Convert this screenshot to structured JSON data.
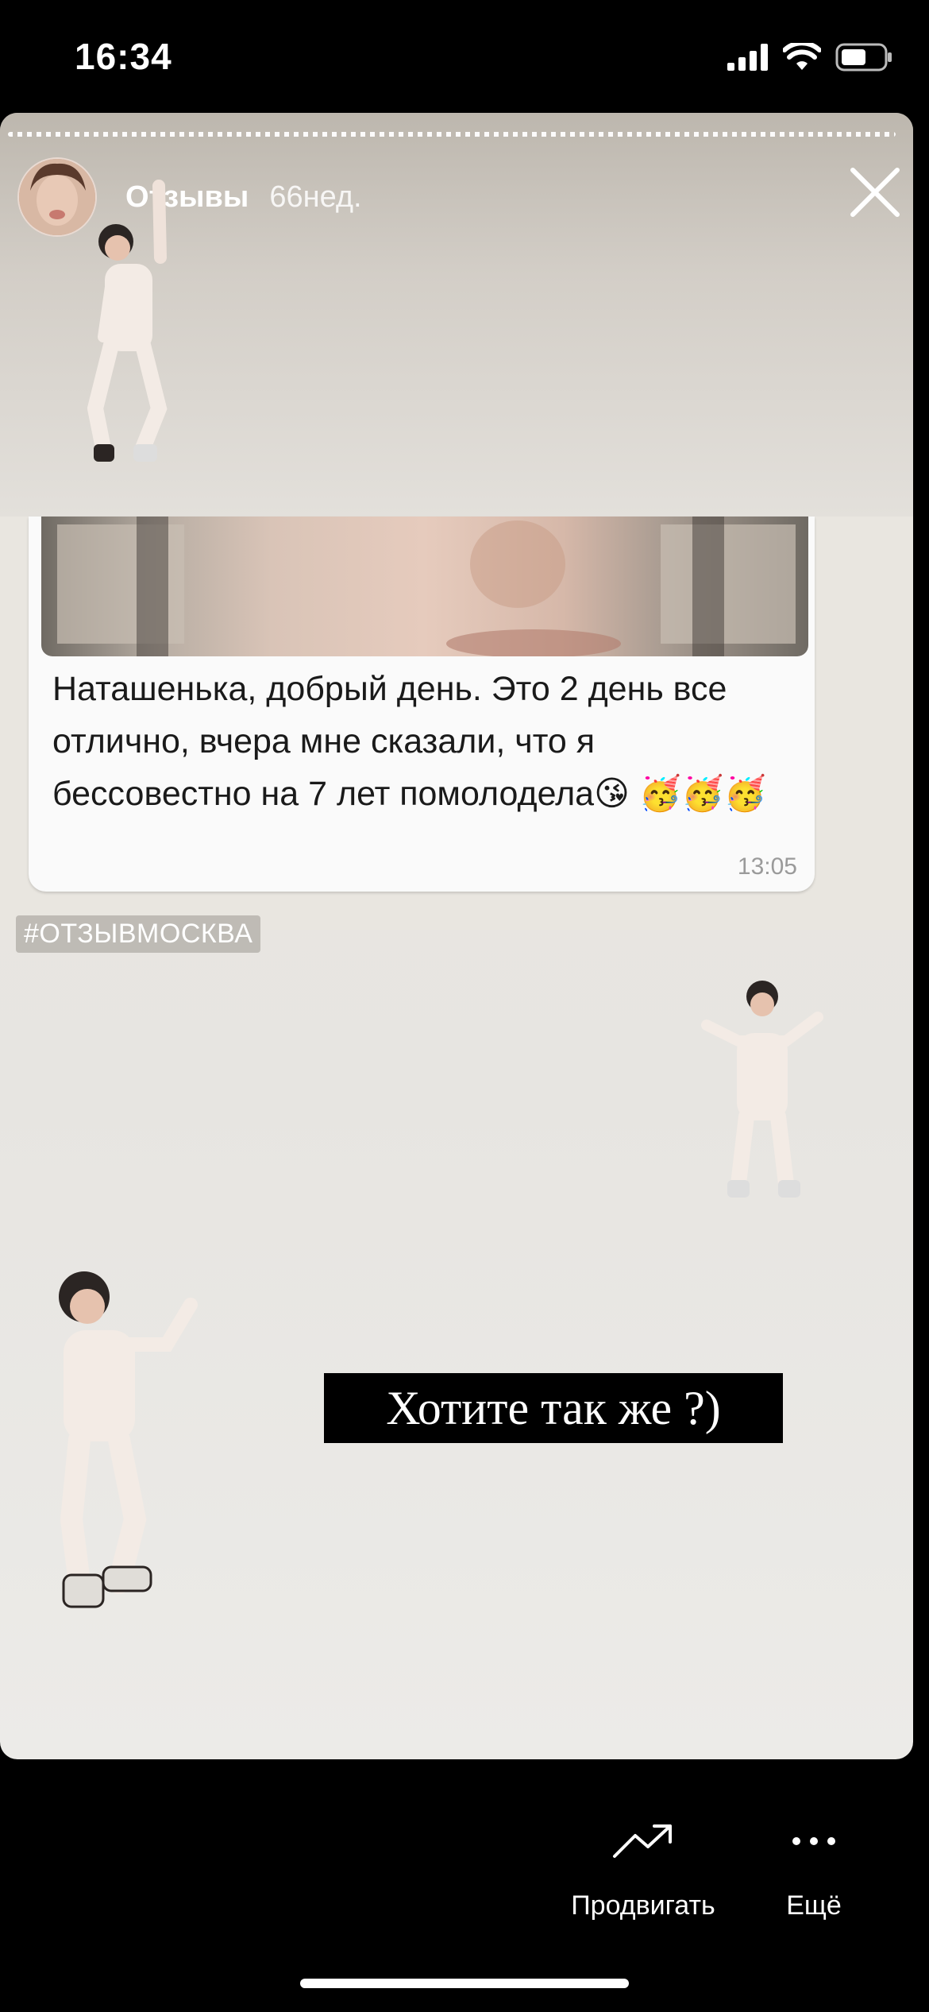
{
  "status_bar": {
    "time": "16:34"
  },
  "story": {
    "account_name": "Отзывы",
    "age": "66нед.",
    "chat": {
      "message_text": "Наташенька, добрый день.  Это 2 день все отлично, вчера мне сказали, что я бессовестно на 7 лет помолодела😘 🥳🥳🥳",
      "time": "13:05"
    },
    "hashtag": "#ОТЗЫВМОСКВА",
    "cta_text": "Хотите так же ?)"
  },
  "footer": {
    "promote_label": "Продвигать",
    "more_label": "Ещё"
  },
  "icons": [
    "signal-icon",
    "wifi-icon",
    "battery-icon",
    "close-icon",
    "trend-up-icon",
    "more-dots-icon"
  ]
}
